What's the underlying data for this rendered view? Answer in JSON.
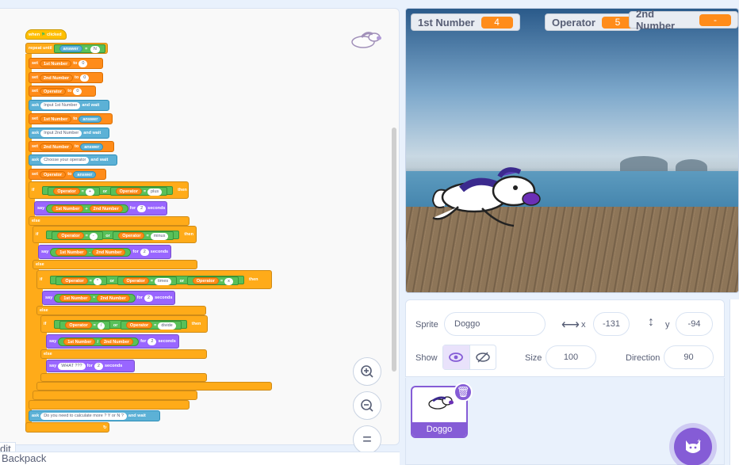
{
  "code": {
    "hat": {
      "when": "when",
      "flag": "flag-icon",
      "clicked": "clicked"
    },
    "repeat_until": "repeat until",
    "answer": "answer",
    "eq": "=",
    "N": "N",
    "set": "set",
    "to": "to",
    "v1": "1st Number",
    "v2": "2nd Number",
    "vop": "Operator",
    "zero": "0",
    "ask": "ask",
    "and_wait": "and wait",
    "ask1": "Input 1st Number",
    "ask2": "Input 2nd Number",
    "ask3": "Choose your operator",
    "if": "if",
    "then": "then",
    "else": "else",
    "or": "or",
    "say": "say",
    "for": "for",
    "seconds": "seconds",
    "two": "2",
    "plus_sym": "+",
    "plus_word": "plus",
    "minus_sym": "-",
    "minus_word": "minus",
    "times_sym": "*",
    "times_word": "times",
    "x": "x",
    "div_sym": "/",
    "div_word": "divide",
    "what": "WHAT ???",
    "ask_more": "Do you need to calculate more ? Y or N ?",
    "zoom_in": "+",
    "zoom_out": "−",
    "zoom_reset": "="
  },
  "tabs": {
    "edit": "dit",
    "backpack": "Backpack"
  },
  "stage": {
    "monitors": [
      {
        "label": "1st Number",
        "value": "4"
      },
      {
        "label": "Operator",
        "value": "5"
      },
      {
        "label": "2nd Number",
        "value": "-"
      }
    ]
  },
  "sprite_info": {
    "sprite_label": "Sprite",
    "sprite_name": "Doggo",
    "x_label": "x",
    "x_value": "-131",
    "y_label": "y",
    "y_value": "-94",
    "show_label": "Show",
    "size_label": "Size",
    "size_value": "100",
    "direction_label": "Direction",
    "direction_value": "90"
  },
  "sprites": [
    {
      "name": "Doggo"
    }
  ],
  "colors": {
    "accent": "#855cd6",
    "variables": "#ff8c1a",
    "control": "#ffab19",
    "looks": "#9966ff",
    "sensing": "#5cb1d6",
    "operators": "#59c059"
  }
}
